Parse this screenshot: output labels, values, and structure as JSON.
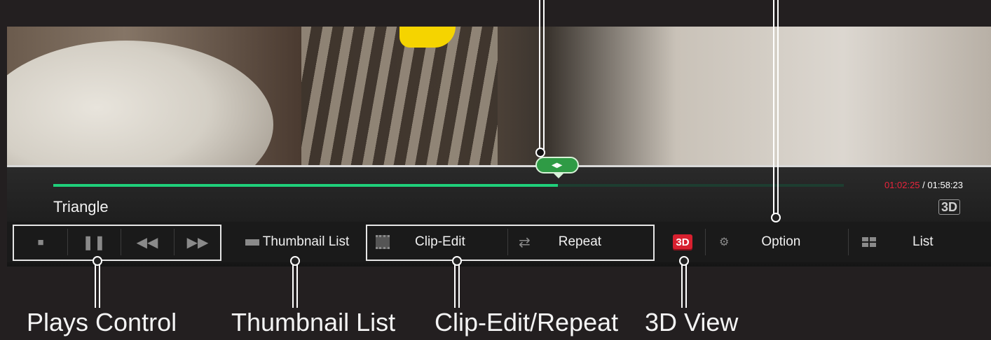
{
  "player": {
    "title": "Triangle",
    "time_current": "01:02:25",
    "time_separator": " / ",
    "time_total": "01:58:23",
    "progress_fraction": 0.638,
    "badge_3d": "3D"
  },
  "controls": {
    "thumbnail_list": "Thumbnail List",
    "clip_edit": "Clip-Edit",
    "repeat": "Repeat",
    "three_d_button": "3D",
    "option": "Option",
    "list": "List"
  },
  "icons": {
    "stop": "stop-icon",
    "pause": "pause-icon",
    "rewind": "rewind-icon",
    "fast_forward": "fast-forward-icon",
    "thumbnail": "thumbnail-icon",
    "clip": "film-icon",
    "repeat": "repeat-icon",
    "option": "gear-icon",
    "list": "grid-icon"
  },
  "callouts": {
    "plays_control": "Plays Control",
    "thumbnail_list": "Thumbnail List",
    "clip_edit_repeat": "Clip-Edit/Repeat",
    "three_d_view": "3D View"
  },
  "colors": {
    "progress": "#1fcf7a",
    "time_current": "#e8243c",
    "three_d_badge": "#d8202f"
  }
}
